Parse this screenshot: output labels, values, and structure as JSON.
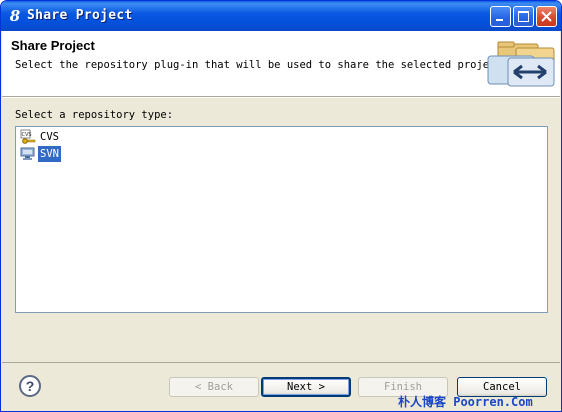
{
  "window": {
    "title": "Share Project",
    "app_icon_glyph": "8",
    "controls": [
      "minimize-icon",
      "maximize-icon",
      "close-icon"
    ]
  },
  "header": {
    "title": "Share Project",
    "description": "Select the repository plug-in that will be used to share the selected project.",
    "image": "share-project-wizard-icon"
  },
  "main": {
    "label": "Select a repository type:",
    "repository_types": [
      {
        "label": "CVS",
        "icon": "cvs-icon",
        "selected": false
      },
      {
        "label": "SVN",
        "icon": "svn-icon",
        "selected": true
      }
    ]
  },
  "buttons": {
    "help": "?",
    "back": "< Back",
    "next": "Next >",
    "finish": "Finish",
    "cancel": "Cancel"
  },
  "watermark": "朴人博客 Poorren.Com",
  "colors": {
    "selection": "#316ac5",
    "titlebar": "#0b5ae3",
    "dialog_bg": "#ece9d8"
  }
}
